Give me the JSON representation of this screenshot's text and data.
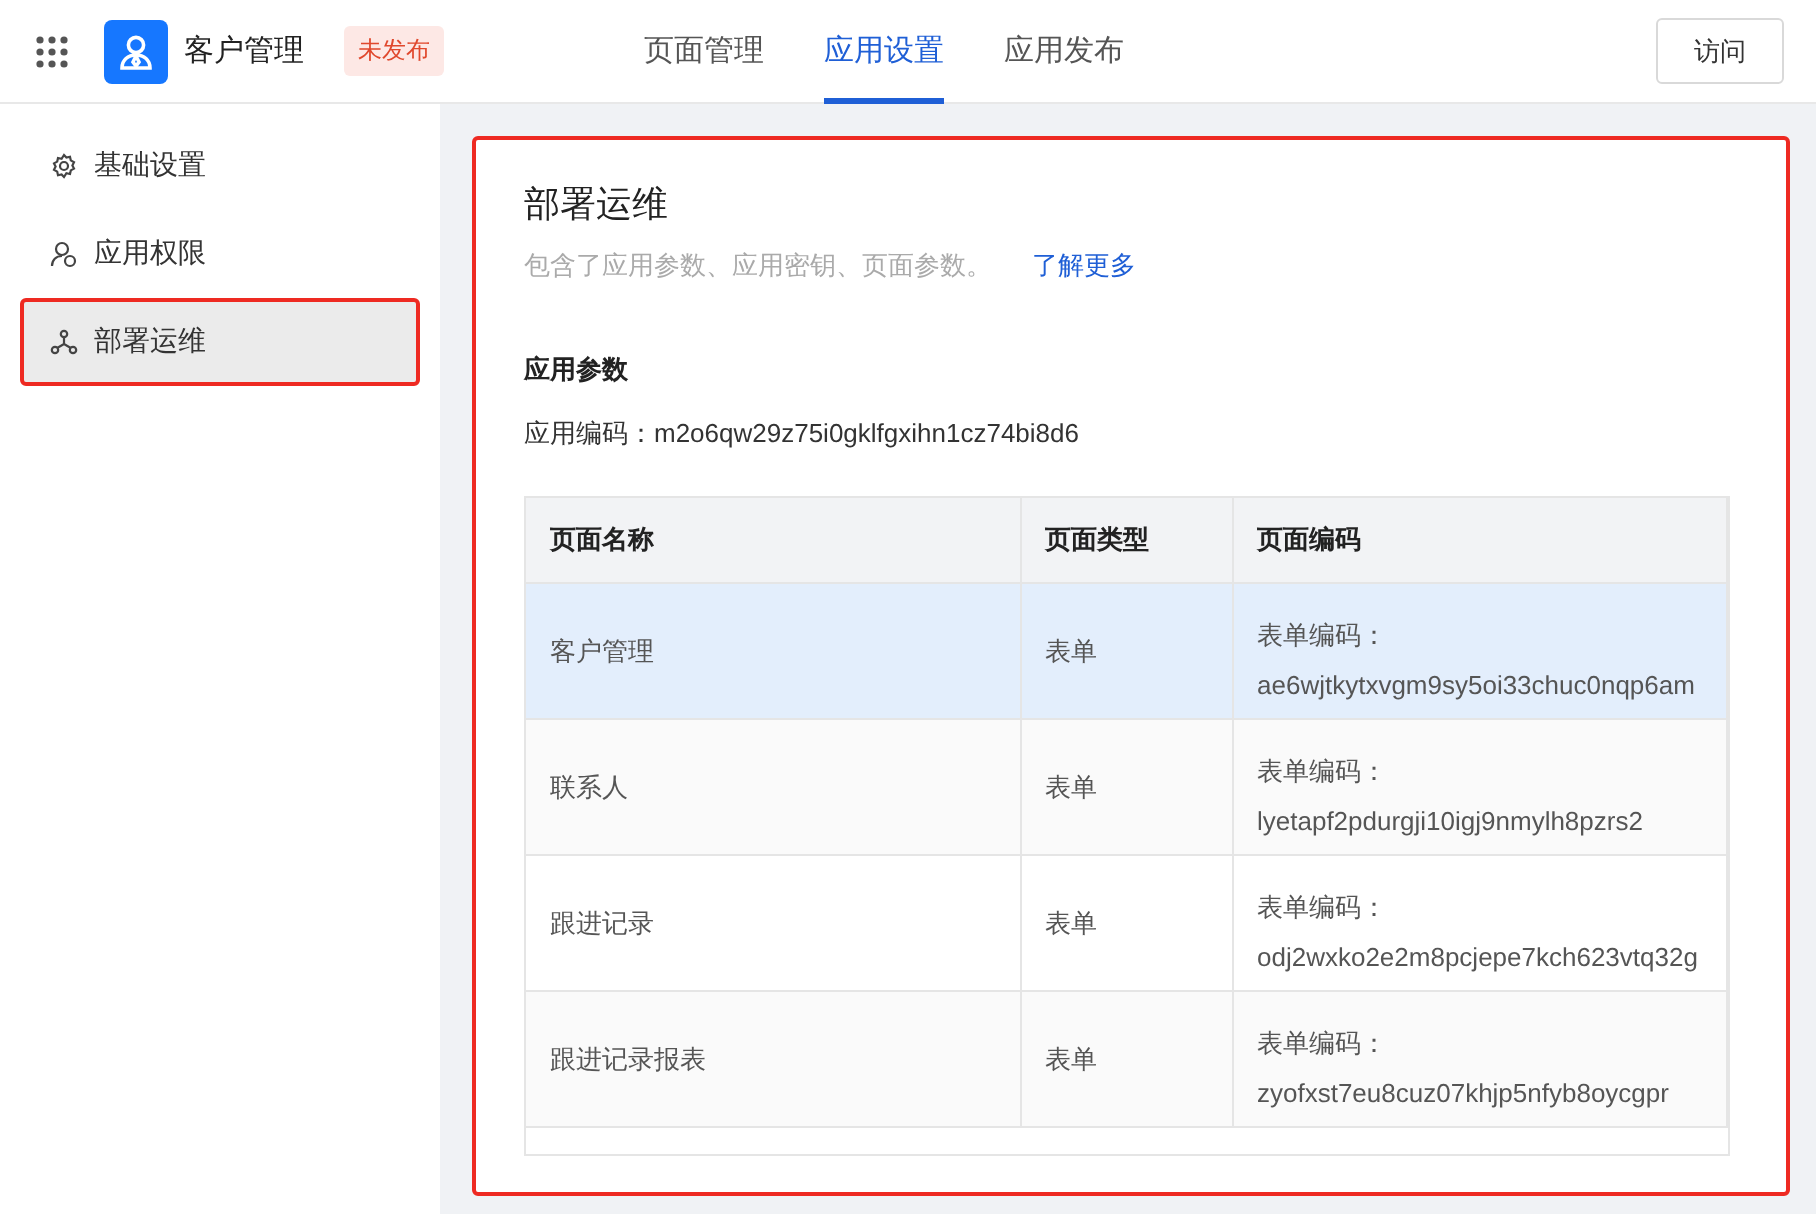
{
  "header": {
    "app_name": "客户管理",
    "status_badge": "未发布",
    "tabs": [
      {
        "label": "页面管理",
        "selected": false
      },
      {
        "label": "应用设置",
        "selected": true
      },
      {
        "label": "应用发布",
        "selected": false
      }
    ],
    "visit_button": "访问"
  },
  "sidebar": {
    "items": [
      {
        "label": "基础设置",
        "kind": "gear",
        "selected": false,
        "highlighted": false
      },
      {
        "label": "应用权限",
        "kind": "user",
        "selected": false,
        "highlighted": false
      },
      {
        "label": "部署运维",
        "kind": "nodes",
        "selected": true,
        "highlighted": true
      }
    ]
  },
  "panel": {
    "highlighted": true,
    "title": "部署运维",
    "description": "包含了应用参数、应用密钥、页面参数。",
    "learn_more_link": "了解更多",
    "section_title": "应用参数",
    "app_code": "应用编码：m2o6qw29z75i0gklfgxihn1cz74bi8d6",
    "table": {
      "columns": [
        "页面名称",
        "页面类型",
        "页面编码"
      ],
      "rows": [
        {
          "selected": true,
          "cells": [
            "客户管理",
            "表单",
            "表单编码：",
            "ae6wjtkytxvgm9sy5oi33chuc0nqp6am"
          ]
        },
        {
          "selected": false,
          "cells": [
            "联系人",
            "表单",
            "表单编码：",
            "lyetapf2pdurgji10igj9nmylh8pzrs2"
          ]
        },
        {
          "selected": false,
          "cells": [
            "跟进记录",
            "表单",
            "表单编码：",
            "odj2wxko2e2m8pcjepe7kch623vtq32g"
          ]
        },
        {
          "selected": false,
          "cells": [
            "跟进记录报表",
            "表单",
            "表单编码：",
            "zyofxst7eu8cuz07khjp5nfyb8oycgpr"
          ]
        }
      ]
    }
  }
}
